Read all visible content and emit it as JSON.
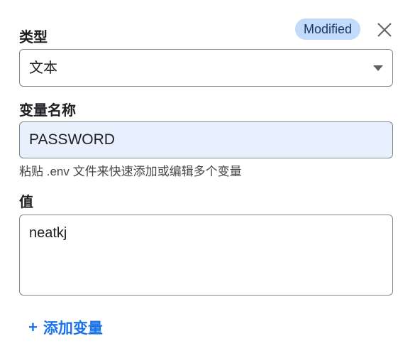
{
  "type_field": {
    "label": "类型",
    "selected_value": "文本"
  },
  "status_badge": "Modified",
  "name_field": {
    "label": "变量名称",
    "value": "PASSWORD",
    "hint": "粘贴 .env 文件来快速添加或编辑多个变量"
  },
  "value_field": {
    "label": "值",
    "value": "neatkj"
  },
  "add_variable": {
    "icon": "+",
    "label": "添加变量"
  },
  "colors": {
    "badge_bg": "#c2dbfb",
    "input_highlight": "#e8f0fe",
    "accent": "#1a73e8"
  },
  "icons": {
    "close": "close-icon",
    "dropdown": "chevron-down-icon",
    "add": "plus-icon"
  }
}
